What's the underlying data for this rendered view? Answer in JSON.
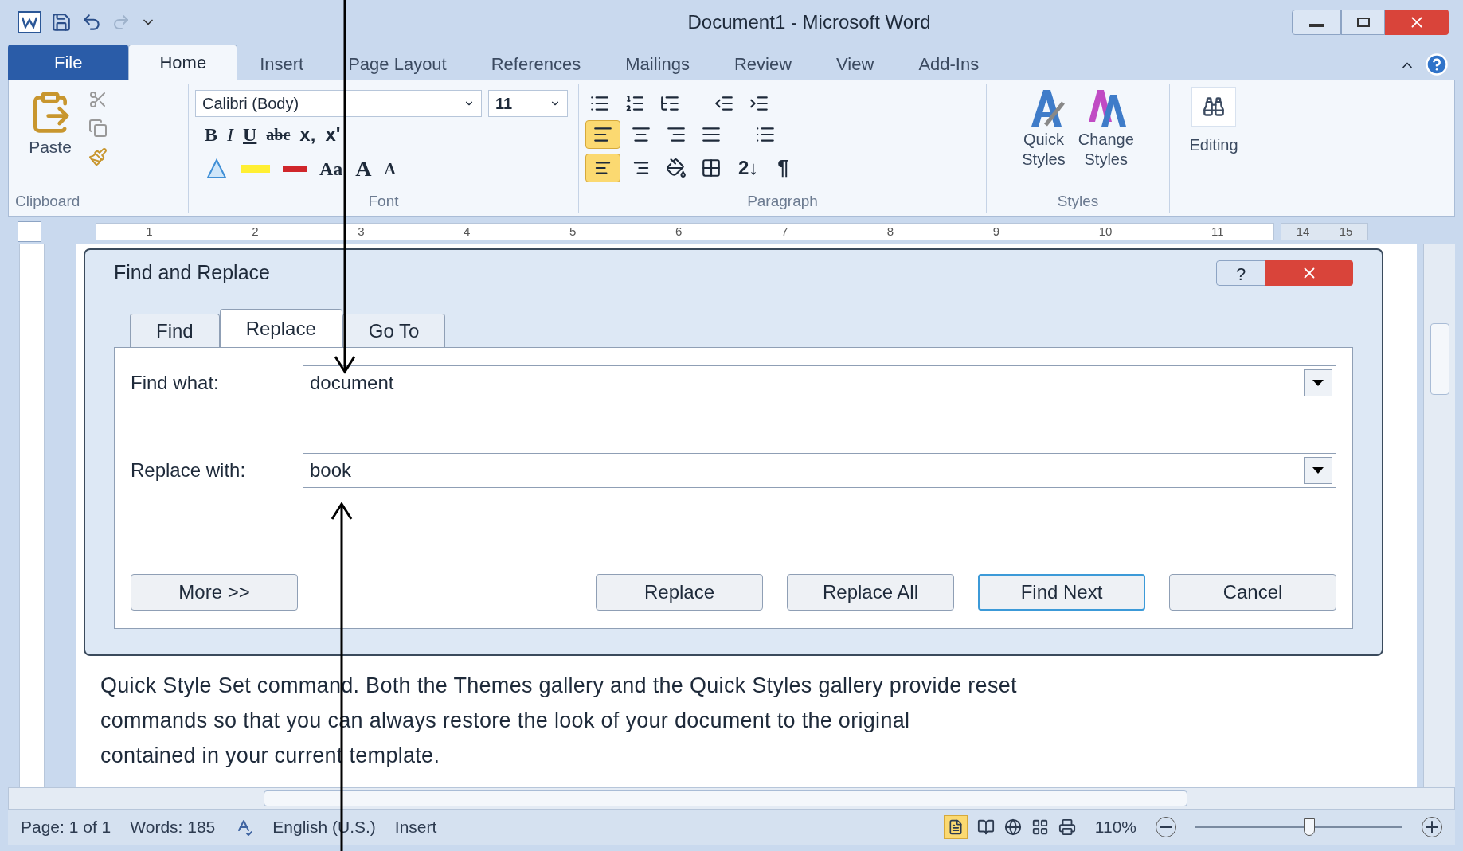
{
  "window": {
    "title": "Document1 - Microsoft Word"
  },
  "ribbon_tabs": [
    {
      "label": "File",
      "kind": "file",
      "selected": false
    },
    {
      "label": "Home",
      "kind": "tab",
      "selected": true
    },
    {
      "label": "Insert",
      "kind": "tab",
      "selected": false
    },
    {
      "label": "Page Layout",
      "kind": "tab",
      "selected": false
    },
    {
      "label": "References",
      "kind": "tab",
      "selected": false
    },
    {
      "label": "Mailings",
      "kind": "tab",
      "selected": false
    },
    {
      "label": "Review",
      "kind": "tab",
      "selected": false
    },
    {
      "label": "View",
      "kind": "tab",
      "selected": false
    },
    {
      "label": "Add-Ins",
      "kind": "tab",
      "selected": false
    }
  ],
  "clipboard": {
    "paste": "Paste",
    "group_label": "Clipboard"
  },
  "font": {
    "name": "Calibri (Body)",
    "size": "11",
    "bold": "B",
    "italic": "I",
    "underline": "U",
    "strikethrough": "abc",
    "subscript": "x,",
    "superscript": "x'",
    "change_case": "Aa",
    "grow": "A",
    "shrink": "A",
    "group_label": "Font"
  },
  "paragraph": {
    "align_left_selected": true,
    "ltr_selected": true,
    "sort": "2↓",
    "pilcrow": "¶",
    "group_label": "Paragraph"
  },
  "styles": {
    "quick_styles": [
      "Quick",
      "Styles"
    ],
    "change_styles": [
      "Change",
      "Styles"
    ],
    "group_label": "Styles"
  },
  "editing": {
    "label": "Editing"
  },
  "ruler": {
    "numbers": [
      "1",
      "2",
      "3",
      "4",
      "5",
      "6",
      "7",
      "8",
      "9",
      "10",
      "11"
    ],
    "right_numbers": [
      "14",
      "15"
    ]
  },
  "dialog": {
    "title": "Find and Replace",
    "help": "?",
    "tabs": [
      {
        "label": "Find",
        "selected": false
      },
      {
        "label": "Replace",
        "selected": true
      },
      {
        "label": "Go To",
        "selected": false
      }
    ],
    "fields": [
      {
        "label": "Find what:",
        "value": "document"
      },
      {
        "label": "Replace with:",
        "value": "book"
      }
    ],
    "more_button": "More >>",
    "buttons": [
      {
        "label": "Replace",
        "default": false
      },
      {
        "label": "Replace All",
        "default": false
      },
      {
        "label": "Find Next",
        "default": true
      },
      {
        "label": "Cancel",
        "default": false
      }
    ]
  },
  "document": {
    "lines": [
      "Quick Style Set command. Both the Themes gallery and the Quick Styles gallery provide reset",
      "commands so that you can always restore the look of your document to the original",
      "contained in your current template."
    ]
  },
  "status_bar": {
    "page": "Page: 1 of 1",
    "words": "Words: 185",
    "language": "English (U.S.)",
    "mode": "Insert",
    "zoom": "110%",
    "zoom_slider": {
      "level": 0.55
    }
  }
}
